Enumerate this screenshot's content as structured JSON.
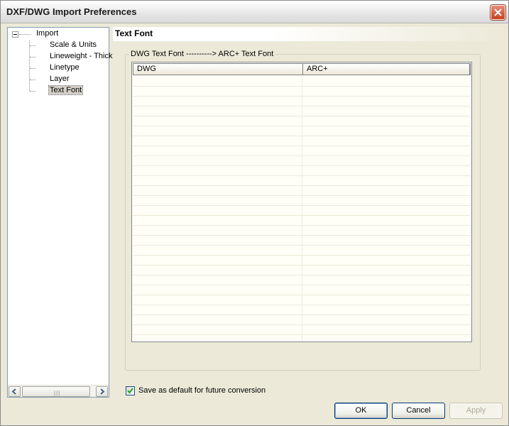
{
  "window": {
    "title": "DXF/DWG Import Preferences"
  },
  "tree": {
    "root": "Import",
    "items": [
      {
        "label": "Scale & Units"
      },
      {
        "label": "Lineweight - Thick"
      },
      {
        "label": "Linetype"
      },
      {
        "label": "Layer"
      },
      {
        "label": "Text Font",
        "selected": true
      }
    ]
  },
  "section": {
    "title": "Text Font"
  },
  "group": {
    "label": "DWG Text Font ----------> ARC+ Text Font"
  },
  "table": {
    "columns": [
      "DWG",
      "ARC+"
    ],
    "rows": []
  },
  "save_default": {
    "label": "Save as default for future conversion",
    "checked": true
  },
  "buttons": {
    "ok": "OK",
    "cancel": "Cancel",
    "apply": "Apply"
  },
  "colors": {
    "dialog_bg": "#ece9d8",
    "close_button": "#c8401f",
    "list_bg": "#fffff8"
  }
}
